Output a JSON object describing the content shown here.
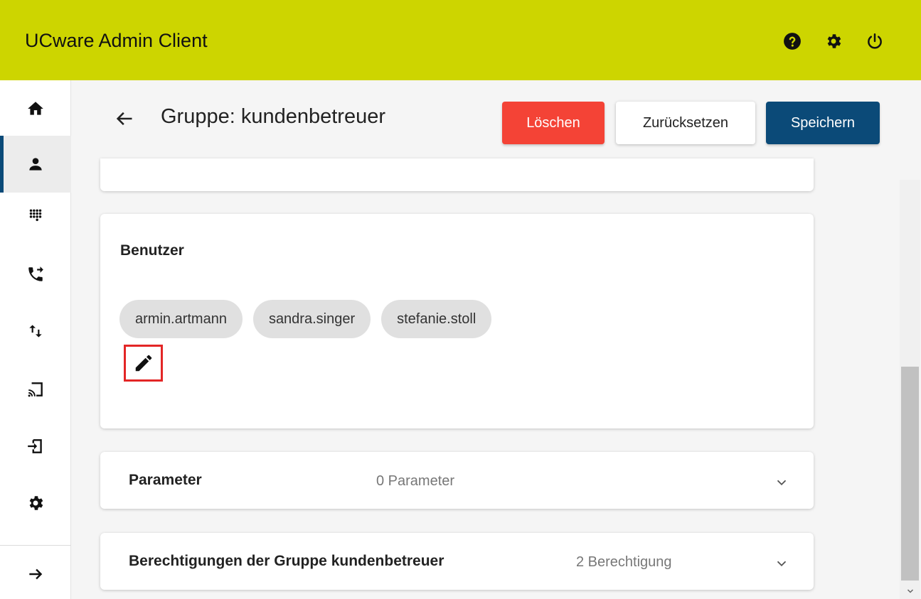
{
  "header": {
    "app_title": "UCware Admin Client",
    "icons": [
      "help-icon",
      "settings-icon",
      "power-icon"
    ],
    "background_color": "#cdd500"
  },
  "sidebar": {
    "items": [
      {
        "icon": "home-icon",
        "active": false
      },
      {
        "icon": "user-icon",
        "active": true
      },
      {
        "icon": "dialpad-icon",
        "active": false
      },
      {
        "icon": "phone-forward-icon",
        "active": false
      },
      {
        "icon": "swap-vert-icon",
        "active": false
      },
      {
        "icon": "cast-icon",
        "active": false
      },
      {
        "icon": "login-icon",
        "active": false
      },
      {
        "icon": "settings-icon",
        "active": false
      },
      {
        "icon": "arrow-right-icon",
        "active": false
      }
    ],
    "active_color": "#0b4a78"
  },
  "page": {
    "title": "Gruppe: kundenbetreuer",
    "back_icon": "arrow-back-icon"
  },
  "actions": {
    "delete_label": "Löschen",
    "reset_label": "Zurücksetzen",
    "save_label": "Speichern",
    "delete_color": "#f44336",
    "save_color": "#0b4a78"
  },
  "users_card": {
    "title": "Benutzer",
    "users": [
      "armin.artmann",
      "sandra.singer",
      "stefanie.stoll"
    ],
    "edit_icon": "pencil-icon"
  },
  "parameters_section": {
    "title": "Parameter",
    "summary": "0 Parameter"
  },
  "permissions_section": {
    "title": "Berechtigungen der Gruppe kundenbetreuer",
    "summary": "2 Berechtigung"
  }
}
